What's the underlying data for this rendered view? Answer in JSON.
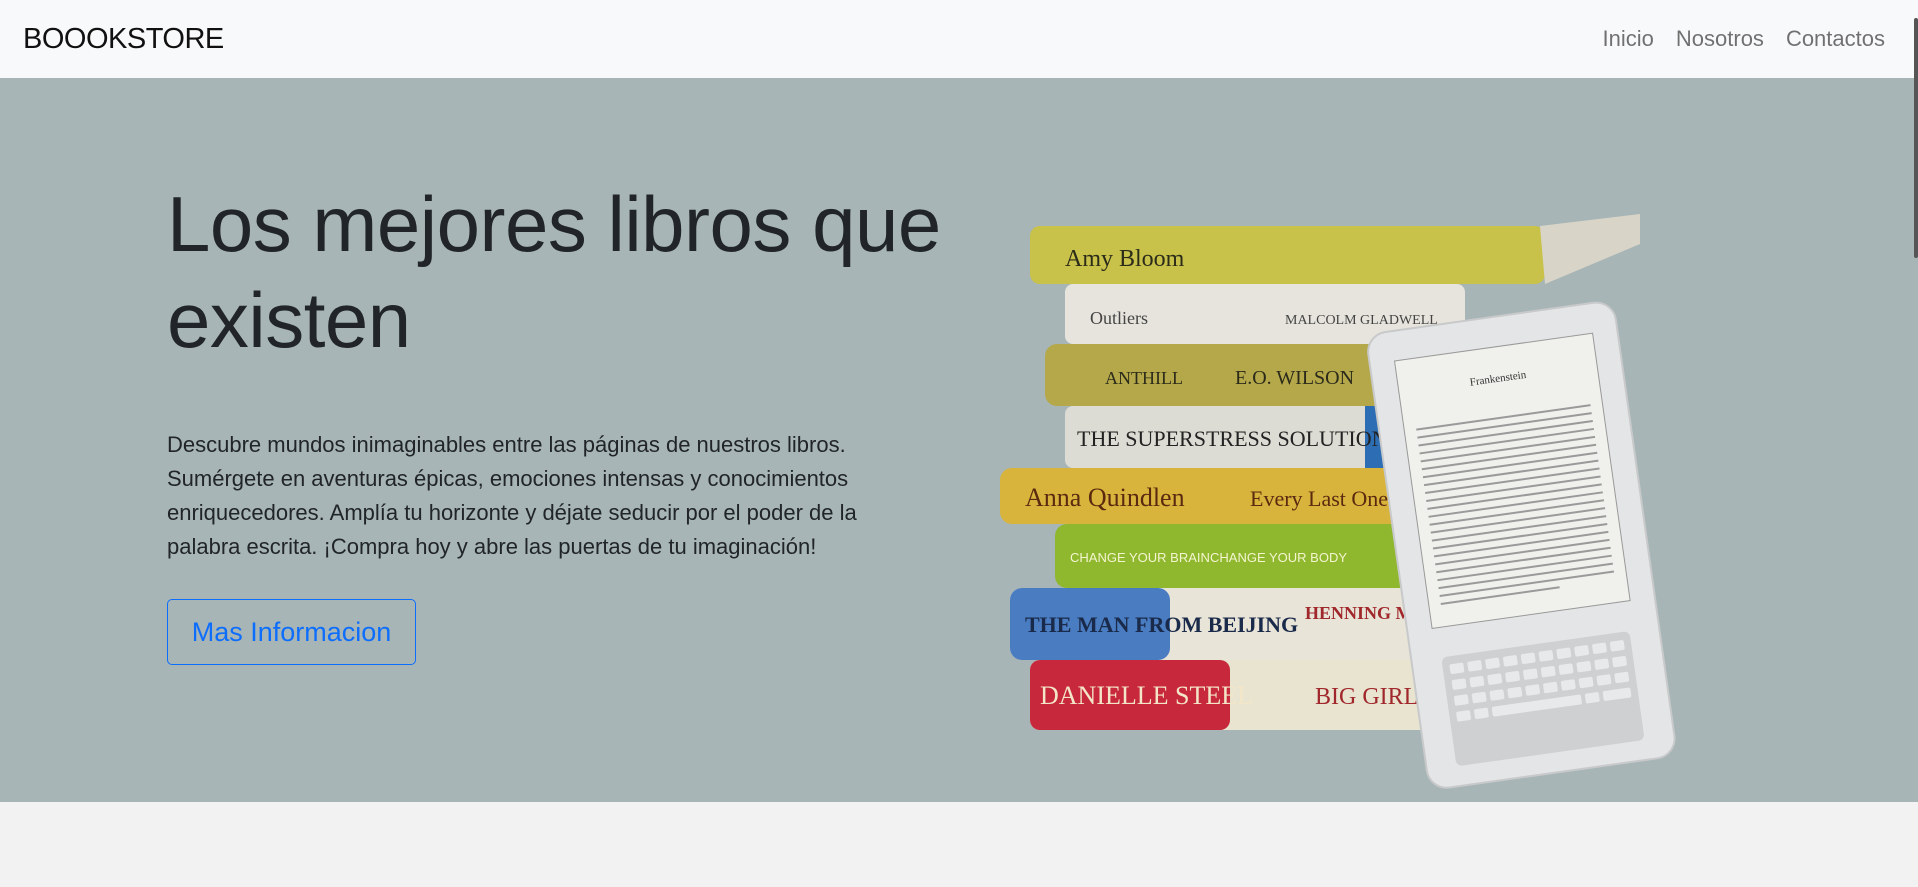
{
  "navbar": {
    "brand": "BOOOKSTORE",
    "links": [
      "Inicio",
      "Nosotros",
      "Contactos"
    ]
  },
  "hero": {
    "title": "Los mejores libros que existen",
    "description": "Descubre mundos inimaginables entre las páginas de nuestros libros. Sumérgete en aventuras épicas, emociones intensas y conocimientos enriquecedores. Amplía tu horizonte y déjate seducir por el poder de la palabra escrita. ¡Compra hoy y abre las puertas de tu imaginación!",
    "button_label": "Mas Informacion",
    "image": {
      "subject": "stack-of-books-with-ereader",
      "book_spines": [
        {
          "title": "Amy Bloom",
          "color": "#c9c24a"
        },
        {
          "title": "Outliers",
          "extra": "MALCOLM GLADWELL",
          "color": "#e6e4dc"
        },
        {
          "title": "ANTHILL",
          "extra": "E.O. WILSON",
          "color": "#b4a84a"
        },
        {
          "title": "THE SUPERSTRESS SOLUTION",
          "color": "#dcdcd4"
        },
        {
          "title": "Anna Quindlen",
          "extra": "Every Last One",
          "color": "#d9b43c"
        },
        {
          "title": "CHANGE YOUR BRAIN",
          "extra": "CHANGE YOUR BODY",
          "color": "#8fb82e"
        },
        {
          "title": "THE MAN FROM BEIJING",
          "extra": "HENNING MANKELL",
          "color": "#e8e4d8"
        },
        {
          "title": "DANIELLE STEEL",
          "extra": "BIG GIRL",
          "color": "#c8283c"
        }
      ],
      "ereader_screen_title": "Frankenstein"
    }
  },
  "colors": {
    "navbar_bg": "#f8f9fa",
    "hero_bg": "#a7b5b6",
    "accent": "#0d6efd",
    "page_bg": "#f2f2f2"
  }
}
